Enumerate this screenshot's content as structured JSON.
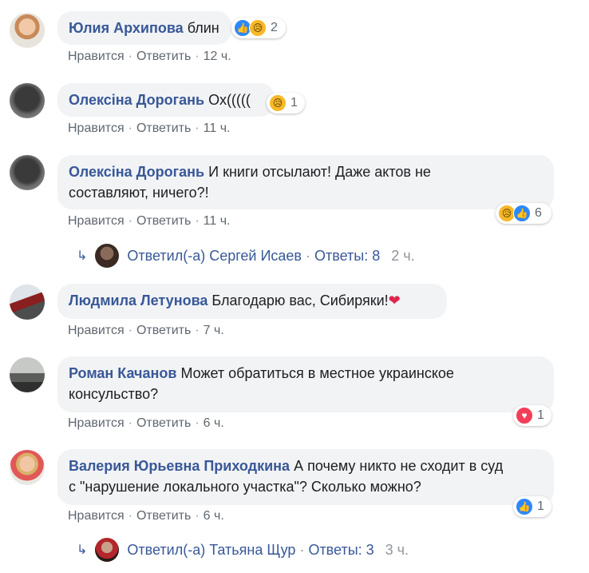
{
  "common": {
    "like": "Нравится",
    "reply": "Ответить",
    "sep": "·"
  },
  "comments": [
    {
      "author": "Юлия Архипова",
      "text": "блин",
      "time": "12 ч.",
      "reaction_count": "2",
      "reactions": [
        "like-icon",
        "sad-icon"
      ]
    },
    {
      "author": "Олексiна Дорогань",
      "text": "Ох(((((",
      "time": "11 ч.",
      "reaction_count": "1",
      "reactions": [
        "sad-icon"
      ]
    },
    {
      "author": "Олексiна Дорогань",
      "text_line1": "И книги отсылают! Даже актов не",
      "text_line2": "составляют, ничего?!",
      "time": "11 ч.",
      "reaction_count": "6",
      "reactions": [
        "sad-icon",
        "like-icon"
      ],
      "reply_summary": {
        "label": "Ответил(-а) Сергей Исаев",
        "count": "Ответы: 8",
        "time": "2 ч."
      }
    },
    {
      "author": "Людмила Летунова",
      "text": "Благодарю вас, Сибиряки!",
      "emoji": "❤",
      "time": "7 ч."
    },
    {
      "author": "Роман Качанов",
      "text_line1": "Может обратиться в местное украинское",
      "text_line2": "консульство?",
      "time": "6 ч.",
      "reaction_count": "1",
      "reactions": [
        "love-icon"
      ]
    },
    {
      "author": "Валерия Юрьевна Приходкина",
      "text_line1": "А почему никто не сходит в суд",
      "text_line2": "с \"нарушение локального участка\"? Сколько можно?",
      "time": "6 ч.",
      "reaction_count": "1",
      "reactions": [
        "like-icon"
      ],
      "reply_summary": {
        "label": "Ответил(-а) Татьяна Щур",
        "count": "Ответы: 3",
        "time": "3 ч."
      }
    }
  ],
  "icons": {
    "like": "👍",
    "sad": "😥",
    "love": "♥",
    "reply_arrow": "↳"
  },
  "colors": {
    "author": "#385898",
    "bubble": "#f2f3f5",
    "meta": "#606770",
    "like": "#2d88ff",
    "love": "#f33e58",
    "sad": "#f7b928"
  }
}
